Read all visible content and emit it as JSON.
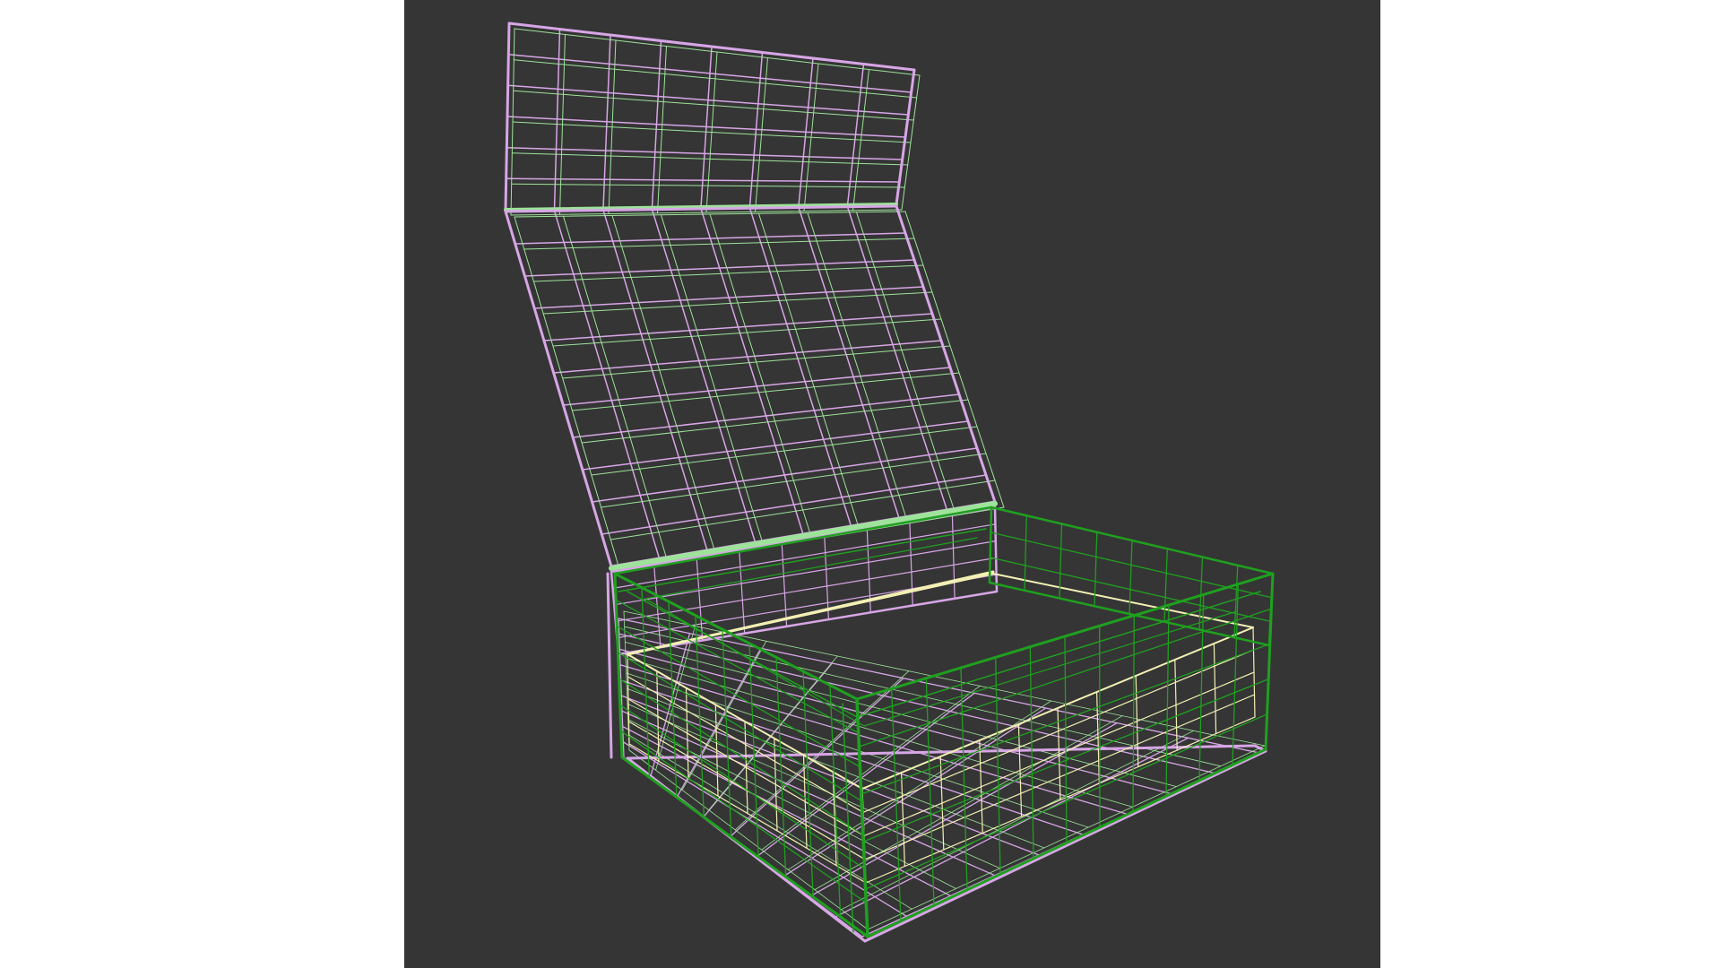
{
  "viewport": {
    "background": "#353535",
    "mode": "wireframe"
  },
  "model": {
    "object": "open-box-with-hinged-lid",
    "parts": [
      {
        "name": "lid-flap",
        "edge_colors": [
          "#d7a6e6",
          "#9ee39a"
        ]
      },
      {
        "name": "lid-panel",
        "edge_colors": [
          "#d7a6e6",
          "#9ee39a"
        ]
      },
      {
        "name": "base-outer",
        "edge_colors": [
          "#1fa01f"
        ]
      },
      {
        "name": "base-inner",
        "edge_colors": [
          "#f2f0b4"
        ]
      },
      {
        "name": "base-floor",
        "edge_colors": [
          "#d7a6e6"
        ]
      }
    ]
  },
  "colors": {
    "purple": "#d7a6e6",
    "light_green": "#9ee39a",
    "green": "#1fa01f",
    "cream": "#f2f0b4"
  }
}
